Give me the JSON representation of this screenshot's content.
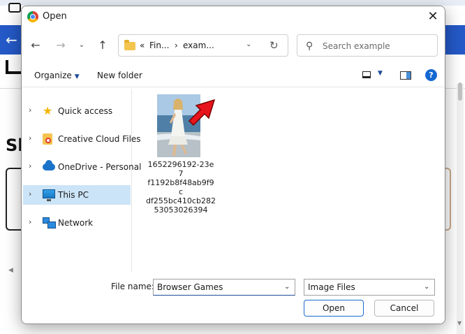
{
  "dialog": {
    "title": "Open",
    "close_glyph": "✕"
  },
  "nav": {
    "back_glyph": "←",
    "forward_glyph": "→",
    "recent_glyph": "⌄",
    "up_glyph": "↑",
    "address": {
      "chevrons": "«",
      "segment1": "Fin...",
      "separator": "›",
      "segment2": "exam...",
      "dropdown_glyph": "⌄",
      "refresh_glyph": "↻"
    },
    "search": {
      "placeholder": "Search example",
      "glyph": "⚲"
    }
  },
  "toolbar": {
    "organize_label": "Organize",
    "caret_glyph": "▼",
    "new_folder_label": "New folder",
    "help_glyph": "?"
  },
  "navpane": {
    "chevron_glyph": "›",
    "items": [
      {
        "label": "Quick access",
        "icon": "star-icon"
      },
      {
        "label": "Creative Cloud Files",
        "icon": "creative-cloud-folder-icon"
      },
      {
        "label": "OneDrive - Personal",
        "icon": "onedrive-cloud-icon"
      },
      {
        "label": "This PC",
        "icon": "this-pc-icon",
        "selected": true
      },
      {
        "label": "Network",
        "icon": "network-icon"
      }
    ]
  },
  "files": [
    {
      "name_lines": [
        "1652296192-23e7",
        "f1192b8f48ab9f9c",
        "df255bc410cb282",
        "53053026394"
      ]
    }
  ],
  "bottom": {
    "file_name_label": "File name:",
    "file_name_value": "Browser Games",
    "file_type_value": "Image Files",
    "open_label": "Open",
    "cancel_label": "Cancel",
    "caret_glyph": "⌄"
  },
  "background": {
    "heading_fragment": "Sh",
    "back_glyph": "←",
    "scroll_left_glyph": "◀",
    "scroll_down_glyph": "▼"
  },
  "colors": {
    "accent": "#1a6ad0",
    "selection": "#cce4f7",
    "background_navbar": "#2459c7",
    "annotation_arrow": "#e8141b"
  }
}
